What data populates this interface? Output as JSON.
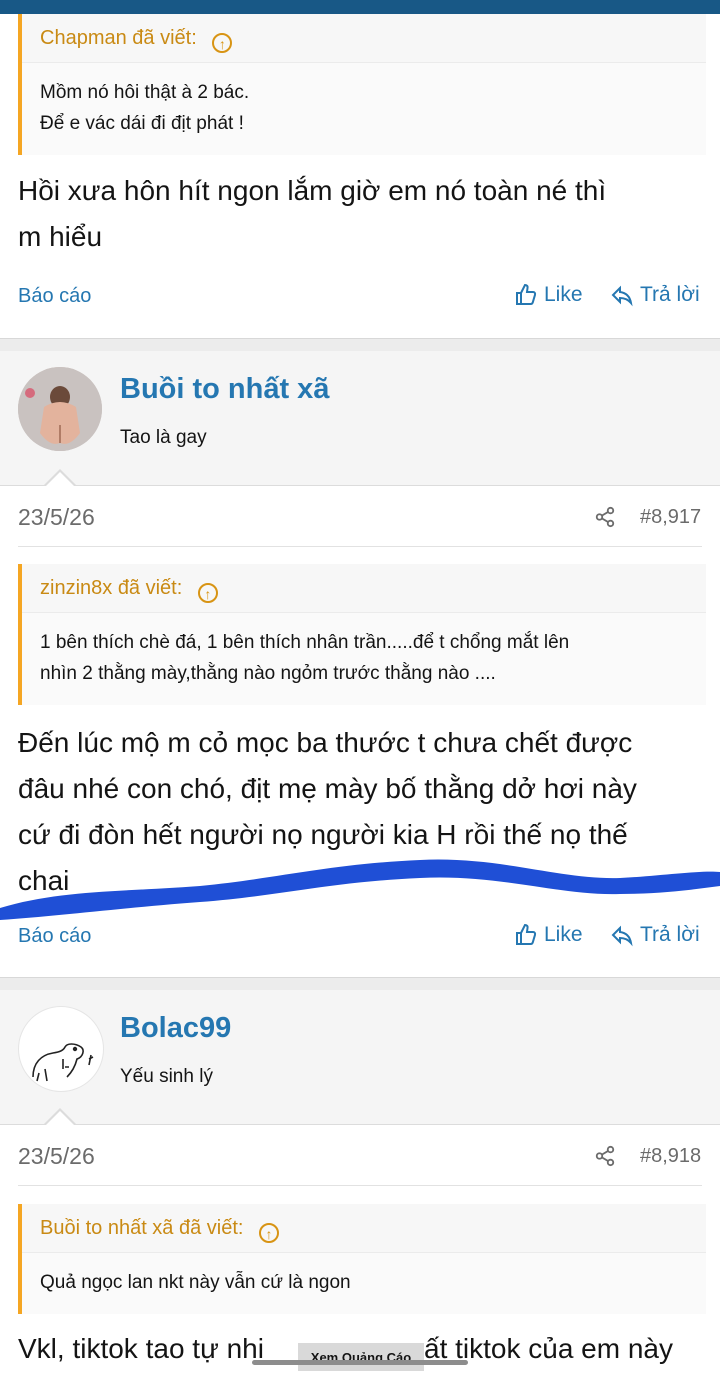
{
  "post1": {
    "quote_author": "Chapman đã viết:",
    "quote_lines": [
      "Mồm nó hôi thật à 2 bác.",
      "Để e vác dái đi địt phát !"
    ],
    "text_lines": [
      "Hồi xưa hôn hít ngon lắm giờ em nó toàn né thì",
      "m hiểu"
    ],
    "report": "Báo cáo",
    "like": "Like",
    "reply": "Trả lời"
  },
  "post2": {
    "username": "Buồi to nhất xã",
    "user_title": "Tao là gay",
    "date": "23/5/26",
    "post_number": "#8,917",
    "quote_author": "zinzin8x đã viết:",
    "quote_lines": [
      "1 bên thích chè đá, 1 bên thích nhân trần.....để t chổng mắt lên",
      "nhìn 2 thằng mày,thằng nào ngỏm trước thằng nào ...."
    ],
    "text_lines": [
      "Đến lúc mộ m cỏ mọc ba thước t chưa chết được",
      "đâu nhé con chó, địt mẹ mày bố thằng dở hơi này",
      "cứ đi đòn hết người nọ người kia H rồi thế nọ thế",
      "chai"
    ],
    "report": "Báo cáo",
    "like": "Like",
    "reply": "Trả lời"
  },
  "post3": {
    "username": "Bolac99",
    "user_title": "Yếu sinh lý",
    "date": "23/5/26",
    "post_number": "#8,918",
    "quote_author": "Buồi to nhất xã đã viết:",
    "quote_lines": [
      "Quả ngọc lan nkt này vẫn cứ là ngon"
    ],
    "text_left": "Vkl, tiktok tao tự nhi",
    "text_right": "ất tiktok của em này"
  },
  "ad_button": "Xem Quảng Cáo",
  "colors": {
    "link": "#2577b1",
    "quote_accent": "#f5a623",
    "topbar": "#185886",
    "scribble": "#1f4fd6"
  }
}
